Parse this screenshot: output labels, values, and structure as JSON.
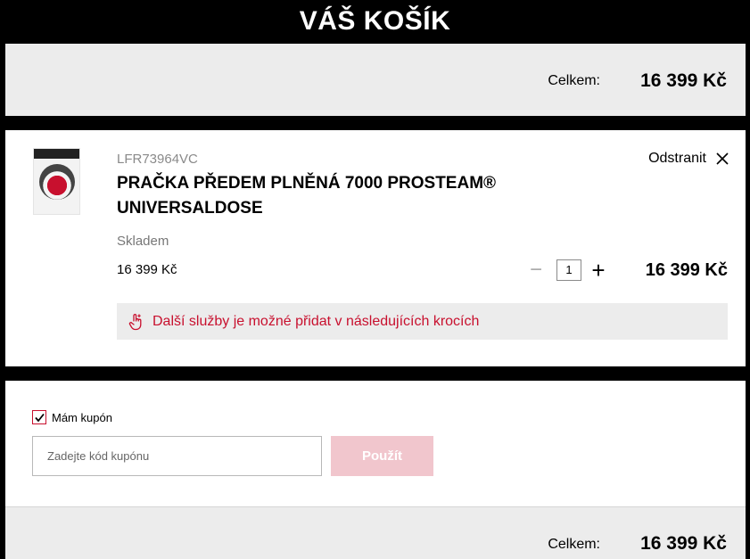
{
  "header": {
    "title": "VÁŠ KOŠÍK"
  },
  "summary_top": {
    "label": "Celkem:",
    "amount": "16 399 Kč"
  },
  "item": {
    "sku": "LFR73964VC",
    "name": "PRAČKA PŘEDEM PLNĚNÁ 7000 PROSTEAM® UNIVERSALDOSE",
    "remove_label": "Odstranit",
    "stock": "Skladem",
    "unit_price": "16 399 Kč",
    "quantity": "1",
    "qty_minus": "−",
    "qty_plus": "+",
    "line_total": "16 399 Kč",
    "services_notice": "Další služby je možné přidat v následujících krocích"
  },
  "coupon": {
    "checkbox_label": "Mám kupón",
    "checked": true,
    "input_placeholder": "Zadejte kód kupónu",
    "apply_label": "Použít"
  },
  "summary_bottom": {
    "label": "Celkem:",
    "amount": "16 399 Kč"
  },
  "colors": {
    "accent": "#c8102e",
    "panel": "#ececec",
    "apply_disabled": "#f1c6cd"
  }
}
